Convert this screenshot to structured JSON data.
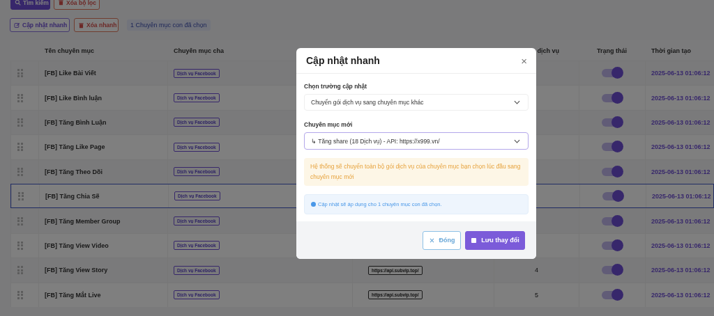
{
  "toolbar": {
    "buttons": [
      {
        "label": "Tìm kiếm",
        "kind": "search"
      },
      {
        "label": "Xóa bộ lọc",
        "kind": "clear"
      }
    ]
  },
  "bulk_actions": {
    "buttons": [
      {
        "label": "Cập nhật nhanh",
        "kind": "edit"
      },
      {
        "label": "Xóa nhanh",
        "kind": "delete"
      }
    ],
    "selection_badge": "1 Chuyên mục con đã chọn"
  },
  "table": {
    "headers": {
      "name": "Tên chuyên mục",
      "parent": "Chuyên mục cha",
      "service_count": "dịch vụ",
      "status": "Trạng thái",
      "created": "Thời gian tạo"
    },
    "rows": [
      {
        "name": "[FB] Like Bài Viết",
        "parent": "Dịch vụ Facebook",
        "on": true,
        "created": "2025-06-13 01:06:12",
        "selected": false
      },
      {
        "name": "[FB] Like Bình luận",
        "parent": "Dịch vụ Facebook",
        "on": true,
        "created": "2025-06-13 01:06:12",
        "selected": false
      },
      {
        "name": "[FB] Tăng Bình Luận",
        "parent": "Dịch vụ Facebook",
        "on": true,
        "created": "2025-06-13 01:06:12",
        "selected": false
      },
      {
        "name": "[FB] Tăng Like Page",
        "parent": "Dịch vụ Facebook",
        "on": true,
        "created": "2025-06-13 01:06:12",
        "selected": false
      },
      {
        "name": "[FB] Tăng Theo Dõi",
        "parent": "Dịch vụ Facebook",
        "on": true,
        "created": "2025-06-13 01:06:12",
        "selected": false
      },
      {
        "name": "[FB] Tăng Chia Sẽ",
        "parent": "Dịch vụ Facebook",
        "on": true,
        "created": "2025-06-13 01:06:12",
        "selected": true
      },
      {
        "name": "[FB] Tăng Member Group",
        "parent": "Dịch vụ Facebook",
        "on": true,
        "created": "2025-06-13 01:06:12",
        "selected": false
      },
      {
        "name": "[FB] Tăng View Video",
        "parent": "Dịch vụ Facebook",
        "on": true,
        "created": "2025-06-13 01:06:12",
        "selected": false
      },
      {
        "name": "[FB] Tăng View Story",
        "parent": "Dịch vụ Facebook",
        "api": "https://api.subvip.top/",
        "count": "4",
        "on": true,
        "created": "2025-06-13 01:06:12",
        "selected": false
      },
      {
        "name": "[FB] Tăng Mắt Live",
        "parent": "Dịch vụ Facebook",
        "api": "https://api.subvip.top/",
        "count": "5",
        "on": true,
        "created": "2025-06-13 01:06:12",
        "selected": false
      }
    ]
  },
  "modal": {
    "title": "Cập nhật nhanh",
    "close": "×",
    "fields": [
      {
        "label": "Chọn trường cập nhật",
        "value": "Chuyển gói dịch vụ sang chuyên mục khác",
        "focused": false
      },
      {
        "label": "Chuyên mục mới",
        "value": "↳ Tăng share (18 Dịch vụ) - API: https://x999.vn/",
        "focused": true
      }
    ],
    "warning": "Hệ thống sẽ chuyển toàn bộ gói dịch vụ của chuyên mục bạn chọn lúc đầu sang chuyên mục mới",
    "info": "Cập nhật sẽ áp dụng cho 1 chuyên mục con đã chọn.",
    "buttons": [
      {
        "label": "Đóng",
        "kind": "cancel"
      },
      {
        "label": "Lưu thay đổi",
        "kind": "save"
      }
    ]
  }
}
